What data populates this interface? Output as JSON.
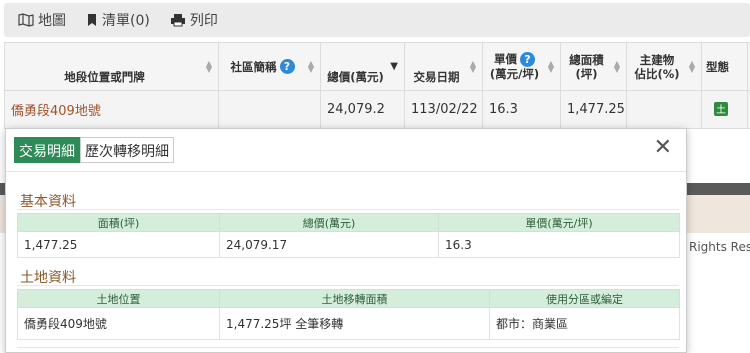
{
  "toolbar": {
    "map": "地圖",
    "list": "清單(0)",
    "print": "列印"
  },
  "grid": {
    "headers": {
      "address": "地段位置或門牌",
      "community": "社區簡稱",
      "total_price": "總價(萬元)",
      "date": "交易日期",
      "unit_price_line1": "單價",
      "unit_price_line2": "(萬元/坪)",
      "area_line1": "總面積",
      "area_line2": "(坪)",
      "main_ratio_line1": "主建物",
      "main_ratio_line2": "佔比(%)",
      "type": "型態"
    },
    "row": {
      "address": "僑勇段409地號",
      "community": "",
      "total_price": "24,079.2",
      "date": "113/02/22",
      "unit_price": "16.3",
      "area": "1,477.25",
      "main_ratio": "",
      "type_badge": "土"
    }
  },
  "background": {
    "rights_text": "Rights Res"
  },
  "popup": {
    "tabs": [
      "交易明細",
      "歷次轉移明細"
    ],
    "close": "✕",
    "basic": {
      "title": "基本資料",
      "headers": [
        "面積(坪)",
        "總價(萬元)",
        "單價(萬元/坪)"
      ],
      "values": [
        "1,477.25",
        "24,079.17",
        "16.3"
      ]
    },
    "land": {
      "title": "土地資料",
      "headers": [
        "土地位置",
        "土地移轉面積",
        "使用分區或編定"
      ],
      "values": [
        "僑勇段409地號",
        "1,477.25坪 全筆移轉",
        "都市：商業區"
      ]
    }
  },
  "colors": {
    "accent_green": "#2e8b57",
    "section_brown": "#8b5a2b",
    "link_brown": "#a0522d",
    "help_blue": "#2c8ad8"
  },
  "icons": [
    "map-icon",
    "bookmark-icon",
    "printer-icon",
    "help-icon",
    "sort-icon",
    "close-icon",
    "land-type-badge"
  ]
}
